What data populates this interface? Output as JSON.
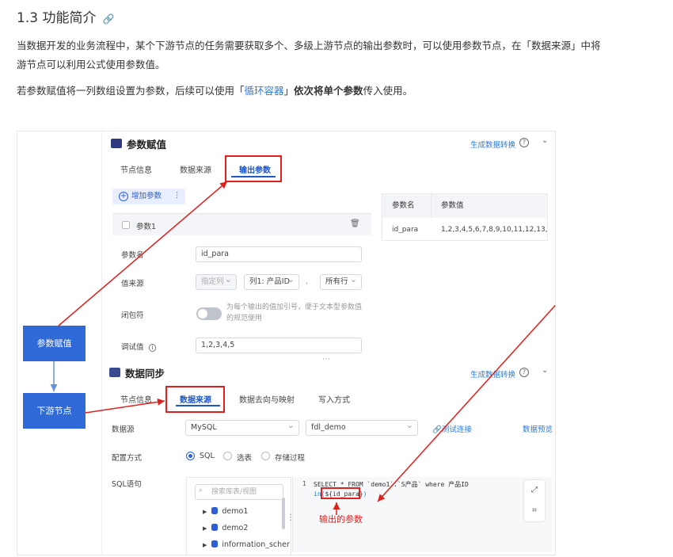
{
  "doc": {
    "heading": "1.3 功能简介",
    "anchor_icon": "link-icon",
    "para1_line1": "当数据开发的业务流程中，某个下游节点的任务需要获取多个、多级上游节点的输出参数时，可以使用参数节点，在「数据来源」中将",
    "para1_line2": "游节点可以利用公式使用参数值。",
    "para2_a": "若参数赋值将一列数组设置为参数，后续可以使用「",
    "para2_link": "循环容器",
    "para2_b": "」",
    "para2_bold": "依次将单个参数",
    "para2_c": "传入使用。"
  },
  "param_assign": {
    "title": "参数赋值",
    "gen_link": "生成数据转换",
    "tabs": [
      "节点信息",
      "数据来源",
      "输出参数"
    ],
    "active_tab": "输出参数",
    "add_button": "增加参数",
    "more_icon": "⋮",
    "param_card_label": "参数1",
    "fields": {
      "name_label": "参数名",
      "name_value": "id_para",
      "source_label": "值来源",
      "source_opt1": "指定列",
      "source_opt2": "列1: 产品ID",
      "source_sep": ",",
      "source_opt3": "所有行",
      "wrap_label": "闭包符",
      "wrap_hint1": "为每个输出的值加引号，便于文本型参数值",
      "wrap_hint2": "的规范使用",
      "debug_label": "调试值",
      "debug_value": "1,2,3,4,5"
    },
    "table": {
      "headers": [
        "参数名",
        "参数值"
      ],
      "rows": [
        [
          "id_para",
          "1,2,3,4,5,6,7,8,9,10,11,12,13,"
        ]
      ]
    }
  },
  "data_sync": {
    "title": "数据同步",
    "gen_link": "生成数据转换",
    "tabs": [
      "节点信息",
      "数据来源",
      "数据去向与映射",
      "写入方式"
    ],
    "active_tab": "数据来源",
    "datasource_label": "数据源",
    "datasource_type": "MySQL",
    "datasource_conn": "fdl_demo",
    "test_conn": "测试连接",
    "preview": "数据预览",
    "config_label": "配置方式",
    "config_opts": [
      "SQL",
      "选表",
      "存储过程"
    ],
    "sql_label": "SQL语句",
    "tree_search_placeholder": "搜索库表/视图",
    "tree_items": [
      "demo1",
      "demo2",
      "information_scher"
    ],
    "code_line_no": "1",
    "code_line1": "SELECT * FROM `demo1`.`S产品` where 产品ID",
    "code_line2_a": "in(",
    "code_line2_param": "${id_para}",
    "code_line2_b": ")"
  },
  "diagram": {
    "box1": "参数赋值",
    "box2": "下游节点",
    "annotation": "输出的参数"
  },
  "colors": {
    "accent_blue": "#2f6ad8",
    "annotation_red": "#e0201c",
    "link_blue": "#2e7bd6"
  }
}
